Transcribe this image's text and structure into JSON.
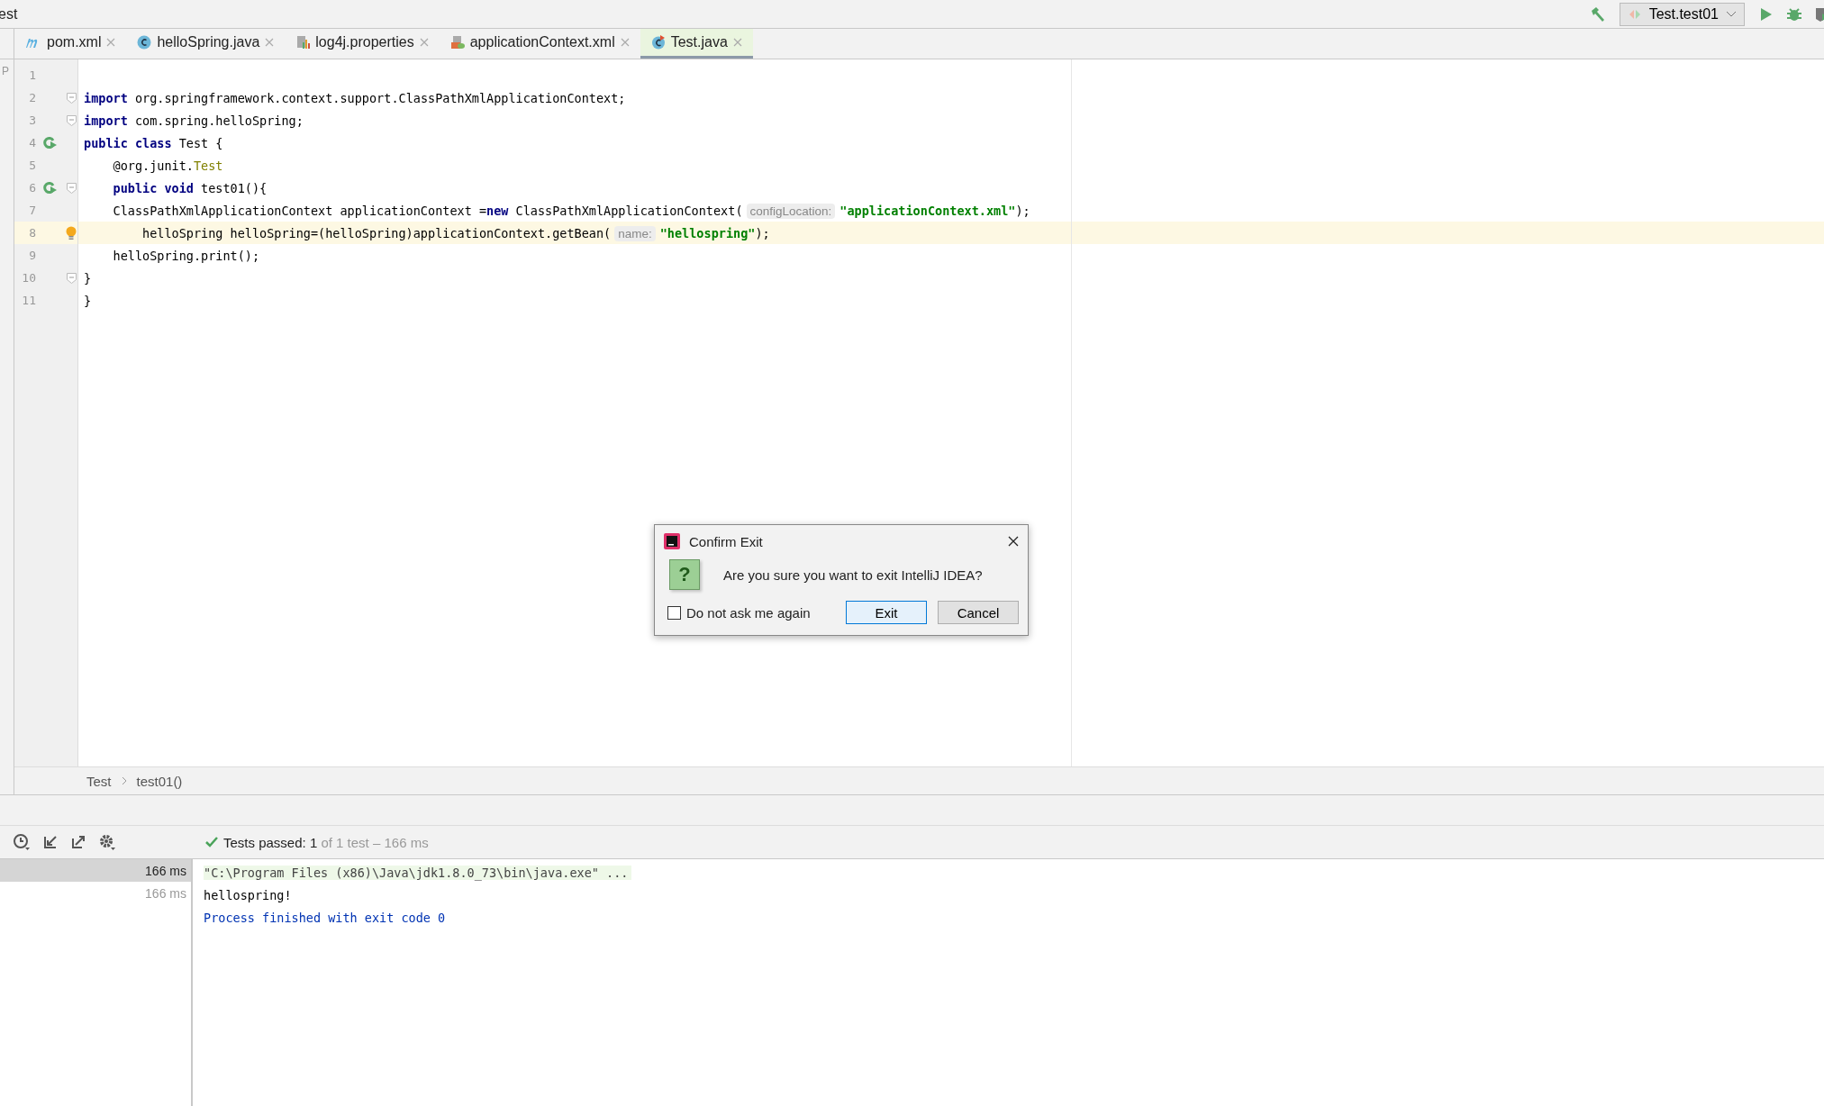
{
  "window": {
    "title": "est",
    "side_label": "P"
  },
  "run_config": {
    "label": "Test.test01"
  },
  "tabs": [
    {
      "label": "pom.xml",
      "kind": "maven",
      "selected": false
    },
    {
      "label": "helloSpring.java",
      "kind": "class",
      "selected": false
    },
    {
      "label": "log4j.properties",
      "kind": "props",
      "selected": false
    },
    {
      "label": "applicationContext.xml",
      "kind": "xml",
      "selected": false
    },
    {
      "label": "Test.java",
      "kind": "test",
      "selected": true
    }
  ],
  "editor": {
    "lines": [
      {
        "number": "1",
        "run": false,
        "fold": false,
        "bulb": false,
        "current": false
      },
      {
        "number": "2",
        "run": false,
        "fold": true,
        "bulb": false,
        "current": false,
        "tokens": [
          {
            "kind": "kw",
            "text": "import"
          },
          {
            "kind": "plain",
            "text": " org.springframework.context.support.ClassPathXmlApplicationContext;"
          }
        ]
      },
      {
        "number": "3",
        "run": false,
        "fold": true,
        "bulb": false,
        "current": false,
        "tokens": [
          {
            "kind": "kw",
            "text": "import"
          },
          {
            "kind": "plain",
            "text": " com.spring.helloSpring;"
          }
        ]
      },
      {
        "number": "4",
        "run": true,
        "fold": false,
        "bulb": false,
        "current": false,
        "tokens": [
          {
            "kind": "kw",
            "text": "public class"
          },
          {
            "kind": "plain",
            "text": " Test {"
          }
        ]
      },
      {
        "number": "5",
        "run": false,
        "fold": false,
        "bulb": false,
        "current": false,
        "tokens": [
          {
            "kind": "plain",
            "text": "    @org.junit."
          },
          {
            "kind": "ann",
            "text": "Test"
          }
        ]
      },
      {
        "number": "6",
        "run": true,
        "fold": true,
        "bulb": false,
        "current": false,
        "tokens": [
          {
            "kind": "kw",
            "text": "    public void"
          },
          {
            "kind": "plain",
            "text": " test01(){"
          }
        ]
      },
      {
        "number": "7",
        "run": false,
        "fold": false,
        "bulb": false,
        "current": false,
        "tokens": [
          {
            "kind": "plain",
            "text": "    ClassPathXmlApplicationContext applicationContext ="
          },
          {
            "kind": "kw",
            "text": "new"
          },
          {
            "kind": "plain",
            "text": " ClassPathXmlApplicationContext("
          },
          {
            "kind": "hint",
            "text": "configLocation:"
          },
          {
            "kind": "str",
            "text": "\"applicationContext.xml\""
          },
          {
            "kind": "plain",
            "text": ");"
          }
        ]
      },
      {
        "number": "8",
        "run": false,
        "fold": false,
        "bulb": true,
        "current": true,
        "tokens": [
          {
            "kind": "plain",
            "text": "        helloSpring helloSpring=(helloSpring)applicationContext.getBean("
          },
          {
            "kind": "hint",
            "text": "name:"
          },
          {
            "kind": "str",
            "text": "\"hellospring\""
          },
          {
            "kind": "plain",
            "text": ");"
          }
        ]
      },
      {
        "number": "9",
        "run": false,
        "fold": false,
        "bulb": false,
        "current": false,
        "tokens": [
          {
            "kind": "plain",
            "text": "    helloSpring.print();"
          }
        ]
      },
      {
        "number": "10",
        "run": false,
        "fold": true,
        "bulb": false,
        "current": false,
        "tokens": [
          {
            "kind": "plain",
            "text": "}"
          }
        ]
      },
      {
        "number": "11",
        "run": false,
        "fold": false,
        "bulb": false,
        "current": false,
        "tokens": [
          {
            "kind": "plain",
            "text": "}"
          }
        ]
      }
    ]
  },
  "breadcrumb": [
    "Test",
    "test01()"
  ],
  "dialog": {
    "title": "Confirm Exit",
    "icon_glyph": "?",
    "message": "Are you sure you want to exit IntelliJ IDEA?",
    "checkbox": {
      "label": "Do not ask me again",
      "checked": false
    },
    "buttons": [
      {
        "label": "Exit",
        "default": true
      },
      {
        "label": "Cancel",
        "default": false
      }
    ]
  },
  "tests": {
    "status_label": "Tests passed:",
    "status_count": "1",
    "status_rest": "of 1 test – 166 ms",
    "tree": [
      {
        "time": "166 ms",
        "selected": true
      },
      {
        "time": "166 ms",
        "selected": false
      }
    ],
    "console": [
      {
        "kind": "cmd",
        "text": "\"C:\\Program Files (x86)\\Java\\jdk1.8.0_73\\bin\\java.exe\" ..."
      },
      {
        "kind": "out",
        "text": "hellospring!"
      },
      {
        "kind": "sys",
        "text": "Process finished with exit code 0"
      }
    ]
  }
}
